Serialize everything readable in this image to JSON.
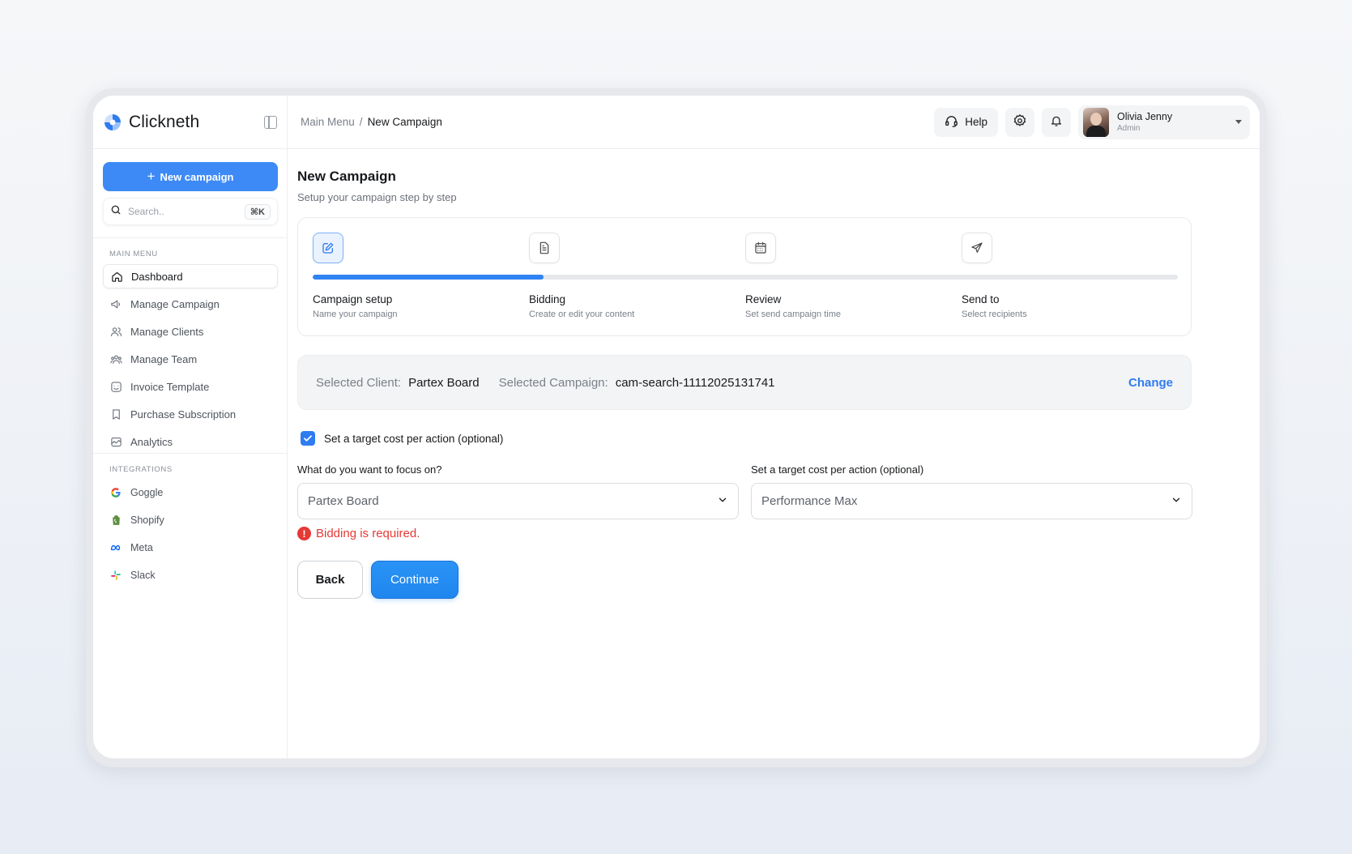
{
  "app": {
    "name": "Clickneth"
  },
  "sidebar": {
    "new_campaign_label": "New campaign",
    "search": {
      "placeholder": "Search..",
      "shortcut": "⌘K"
    },
    "main_menu_label": "MAIN MENU",
    "items": [
      {
        "label": "Dashboard",
        "icon": "home-icon",
        "active": true
      },
      {
        "label": "Manage Campaign",
        "icon": "megaphone-icon"
      },
      {
        "label": "Manage Clients",
        "icon": "users-icon"
      },
      {
        "label": "Manage Team",
        "icon": "team-icon"
      },
      {
        "label": "Invoice Template",
        "icon": "invoice-icon"
      },
      {
        "label": "Purchase Subscription",
        "icon": "bookmark-icon"
      },
      {
        "label": "Analytics",
        "icon": "analytics-icon"
      }
    ],
    "integrations_label": "INTEGRATIONS",
    "integrations": [
      {
        "label": "Goggle",
        "icon": "google-icon"
      },
      {
        "label": "Shopify",
        "icon": "shopify-icon"
      },
      {
        "label": "Meta",
        "icon": "meta-icon"
      },
      {
        "label": "Slack",
        "icon": "slack-icon"
      }
    ]
  },
  "topbar": {
    "breadcrumb": {
      "root": "Main Menu",
      "separator": "/",
      "current": "New Campaign"
    },
    "help_label": "Help",
    "user": {
      "name": "Olivia Jenny",
      "role": "Admin"
    }
  },
  "page": {
    "title": "New Campaign",
    "subtitle": "Setup your campaign step by step"
  },
  "stepper": {
    "progress": 0.267,
    "steps": [
      {
        "title": "Campaign setup",
        "desc": "Name your campaign",
        "icon": "edit-icon",
        "active": true
      },
      {
        "title": "Bidding",
        "desc": "Create or edit your content",
        "icon": "document-icon"
      },
      {
        "title": "Review",
        "desc": "Set send campaign time",
        "icon": "calendar-icon"
      },
      {
        "title": "Send to",
        "desc": "Select recipients",
        "icon": "send-icon"
      }
    ]
  },
  "selection": {
    "client_label": "Selected Client:",
    "client_value": "Partex Board",
    "campaign_label": "Selected Campaign:",
    "campaign_value": "cam-search-11112025131741",
    "change_label": "Change"
  },
  "form": {
    "checkbox_label": "Set a target cost per action (optional)",
    "checkbox_checked": true,
    "focus_label": "What do you want to focus on?",
    "focus_value": "Partex Board",
    "cpa_label": "Set a target cost per action (optional)",
    "cpa_value": "Performance Max",
    "error": "Bidding is required.",
    "back_label": "Back",
    "continue_label": "Continue"
  },
  "colors": {
    "accent": "#3d8af7",
    "error": "#e53935",
    "link": "#2f7cf0"
  }
}
